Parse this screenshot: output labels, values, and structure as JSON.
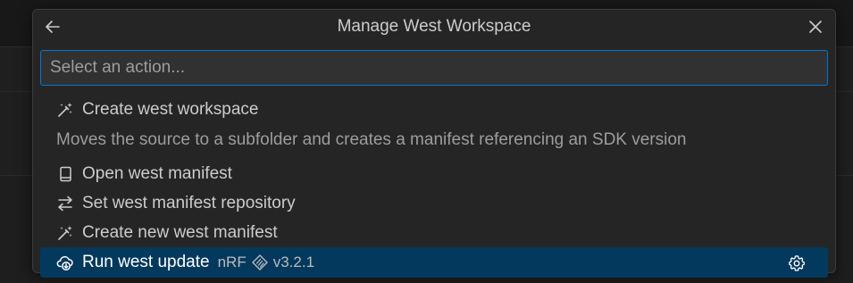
{
  "dialog": {
    "title": "Manage West Workspace",
    "back_icon": "arrow-left-icon",
    "close_icon": "close-icon"
  },
  "search": {
    "placeholder": "Select an action...",
    "value": ""
  },
  "items": [
    {
      "label": "Create west workspace",
      "icon": "sparkle-wand-icon",
      "description": "Moves the source to a subfolder and creates a manifest referencing an SDK version"
    },
    {
      "label": "Open west manifest",
      "icon": "file-icon"
    },
    {
      "label": "Set west manifest repository",
      "icon": "arrows-swap-icon"
    },
    {
      "label": "Create new west manifest",
      "icon": "sparkle-wand-icon"
    },
    {
      "label": "Run west update",
      "icon": "cloud-download-icon",
      "detail_prefix": "nRF",
      "detail_icon": "nrf-sdk-icon",
      "detail_version": "v3.2.1",
      "action_icon": "gear-icon",
      "selected": true
    }
  ],
  "colors": {
    "selection": "#04395e",
    "focus_border": "#0078d4",
    "panel": "#252526"
  }
}
